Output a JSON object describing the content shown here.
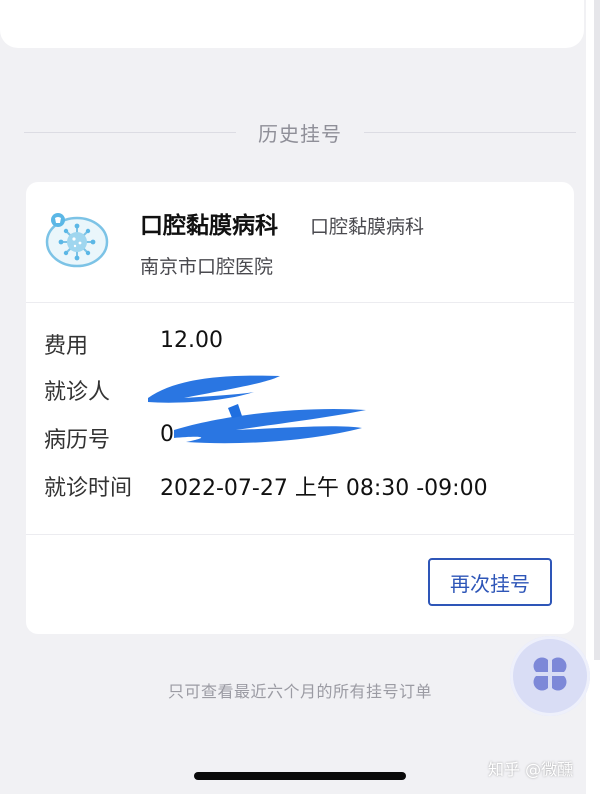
{
  "section": {
    "title": "历史挂号"
  },
  "card": {
    "department": "口腔黏膜病科",
    "department_sub": "口腔黏膜病科",
    "hospital": "南京市口腔医院",
    "rows": {
      "fee": {
        "label": "费用",
        "value": "12.00"
      },
      "patient": {
        "label": "就诊人",
        "value": ""
      },
      "record": {
        "label": "病历号",
        "value": "0"
      },
      "time": {
        "label": "就诊时间",
        "value": "2022-07-27 上午 08:30 -09:00"
      }
    },
    "rebook_label": "再次挂号"
  },
  "footer": {
    "note": "只可查看最近六个月的所有挂号订单"
  },
  "watermark": {
    "text": "知乎 @微醺"
  },
  "icons": {
    "department": "mucosa-virus-icon",
    "floating": "clover-menu-icon"
  },
  "colors": {
    "accent": "#2e56b8",
    "redaction": "#1f6fe0",
    "background": "#f1f1f4"
  }
}
